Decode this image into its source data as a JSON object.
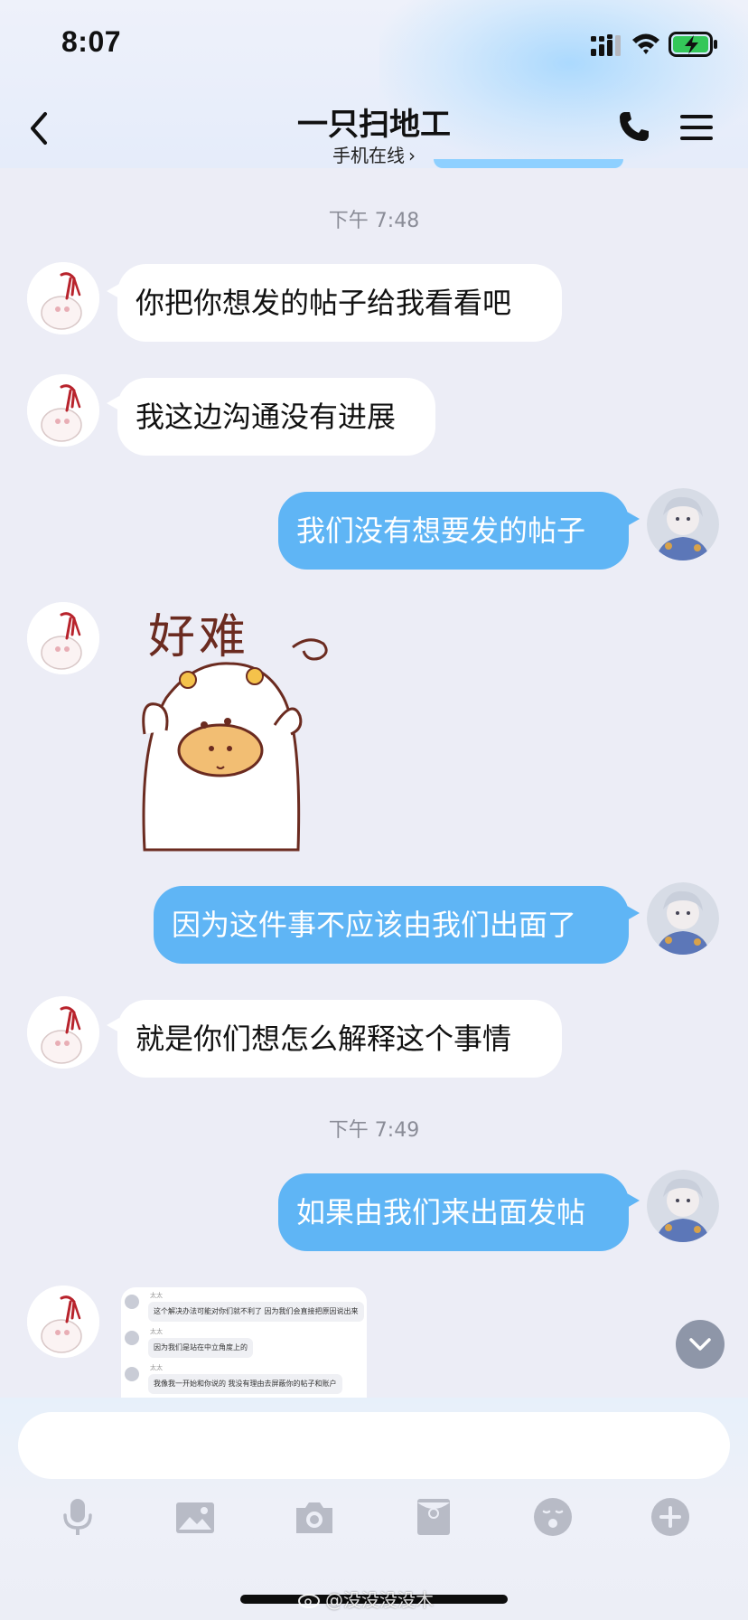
{
  "status_bar": {
    "time": "8:07"
  },
  "header": {
    "contact_name": "一只扫地工",
    "status": "手机在线"
  },
  "messages": {
    "time_1": "下午 7:48",
    "time_2": "下午 7:49",
    "m1": "你把你想发的帖子给我看看吧",
    "m2": "我这边沟通没有进展",
    "m3": "我们没有想要发的帖子",
    "sticker_text": "好难",
    "m5": "因为这件事不应该由我们出面了",
    "m6": "就是你们想怎么解释这个事情",
    "m7": "如果由我们来出面发帖"
  },
  "screenshot_card": {
    "rows": [
      {
        "name": "太太",
        "text": "这个解决办法可能对你们就不利了 因为我们会直接把原因说出来"
      },
      {
        "name": "太太",
        "text": "因为我们是站在中立角度上的"
      },
      {
        "name": "太太",
        "text": "我像我一开始和你说的 我没有理由去屏蔽你的帖子和账户"
      }
    ]
  },
  "input": {
    "placeholder": ""
  },
  "toolbar": {
    "icons": [
      "microphone-icon",
      "image-icon",
      "camera-icon",
      "red-packet-icon",
      "emoji-icon",
      "plus-icon"
    ]
  },
  "watermark": {
    "text": "@没没没没木"
  },
  "colors": {
    "background": "#ECEDF6",
    "outgoing_bubble": "#5FB5F5",
    "incoming_bubble": "#FFFFFF",
    "timestamp": "#8A8C97",
    "icon_gray": "#B8BBC6"
  }
}
